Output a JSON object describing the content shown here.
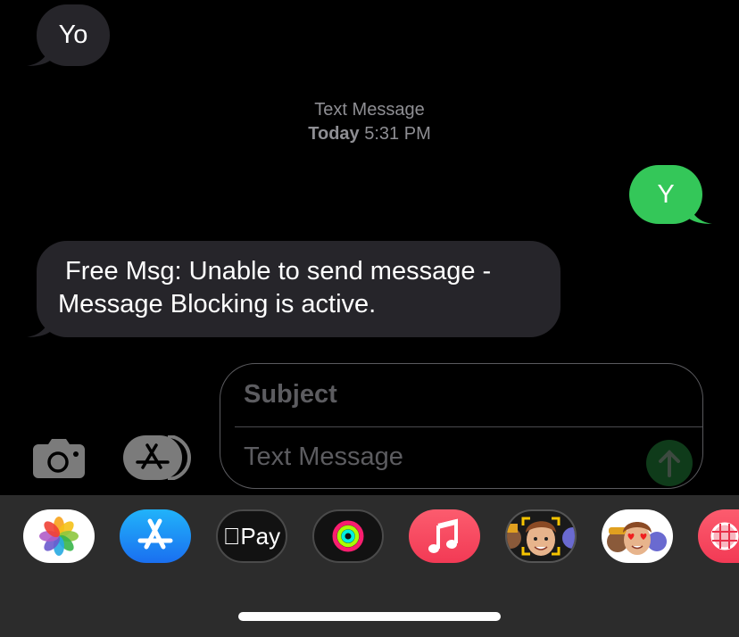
{
  "conversation": {
    "messages": [
      {
        "direction": "received",
        "text": "Yo"
      },
      {
        "direction": "sent",
        "text": "Y"
      },
      {
        "direction": "received",
        "text_line1": " Free Msg: Unable to send message -",
        "text_line2": "Message Blocking is active."
      }
    ],
    "timestamp": {
      "service_label": "Text Message",
      "day": "Today",
      "time": "5:31 PM"
    }
  },
  "composer": {
    "subject_placeholder": "Subject",
    "message_placeholder": "Text Message",
    "send_icon": "arrow-up-icon"
  },
  "toolbar": {
    "camera_icon": "camera-icon",
    "apps_icon": "app-store-icon"
  },
  "app_drawer": {
    "apps": [
      {
        "name": "Photos",
        "icon": "photos-icon"
      },
      {
        "name": "App Store",
        "icon": "app-store-icon"
      },
      {
        "name": "Apple Pay",
        "icon": "apple-pay-icon",
        "label": "Pay"
      },
      {
        "name": "Fitness",
        "icon": "activity-rings-icon"
      },
      {
        "name": "Music",
        "icon": "music-note-icon"
      },
      {
        "name": "Memoji",
        "icon": "memoji-icon"
      },
      {
        "name": "Memoji Stickers",
        "icon": "memoji-stickers-icon"
      },
      {
        "name": "Web Images",
        "icon": "globe-icon"
      }
    ]
  },
  "colors": {
    "sent_bubble": "#34c759",
    "received_bubble": "#26252a",
    "background": "#000000",
    "drawer": "#2c2c2c",
    "meta_text": "#8e8e93"
  }
}
